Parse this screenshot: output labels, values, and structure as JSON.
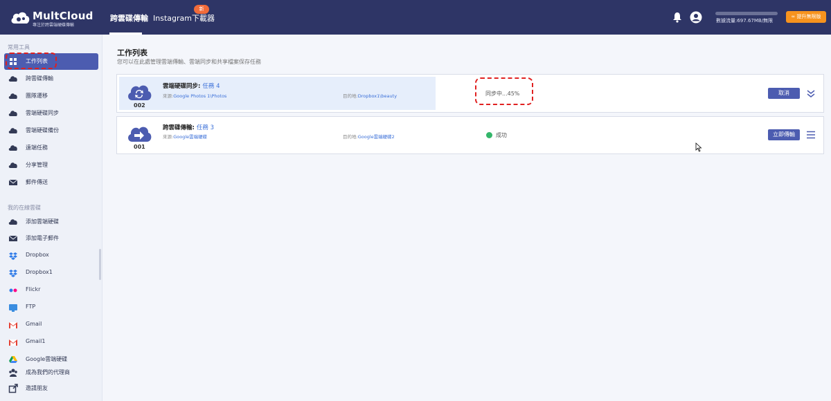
{
  "header": {
    "brand": "MultCloud",
    "tagline": "專注於跨雲端硬碟傳輸",
    "tabs": [
      {
        "label": "跨雲碟傳輸",
        "active": true
      },
      {
        "label": "Instagram下載器",
        "active": false
      }
    ],
    "new_badge": "新",
    "traffic_text": "數據流量:697.67MB/無限",
    "upgrade_label": "∞ 提升無限版",
    "accent_color": "#2e3566"
  },
  "sidebar": {
    "section_common": "常用工具",
    "common_items": [
      {
        "label": "工作列表",
        "icon": "grid-icon"
      },
      {
        "label": "跨雲碟傳輸",
        "icon": "cloud-transfer-icon"
      },
      {
        "label": "團隊遷移",
        "icon": "team-migrate-icon"
      },
      {
        "label": "雲端硬碟同步",
        "icon": "cloud-sync-icon"
      },
      {
        "label": "雲端硬碟備份",
        "icon": "cloud-backup-icon"
      },
      {
        "label": "遠端任務",
        "icon": "remote-task-icon"
      },
      {
        "label": "分享管理",
        "icon": "share-icon"
      },
      {
        "label": "郵件傳送",
        "icon": "mail-icon"
      }
    ],
    "section_online": "我的在線雲碟",
    "online_items": [
      {
        "label": "添加雲端硬碟",
        "icon": "add-cloud-icon"
      },
      {
        "label": "添加電子郵件",
        "icon": "add-mail-icon"
      },
      {
        "label": "Dropbox",
        "icon": "dropbox-icon"
      },
      {
        "label": "Dropbox1",
        "icon": "dropbox-icon"
      },
      {
        "label": "Flickr",
        "icon": "flickr-icon"
      },
      {
        "label": "FTP",
        "icon": "ftp-icon"
      },
      {
        "label": "Gmail",
        "icon": "gmail-icon"
      },
      {
        "label": "Gmail1",
        "icon": "gmail-icon"
      },
      {
        "label": "Google雲端硬碟",
        "icon": "google-drive-icon"
      }
    ],
    "footer_items": [
      {
        "label": "成為我們的代理商",
        "icon": "agent-icon"
      },
      {
        "label": "邀請朋友",
        "icon": "invite-icon"
      }
    ]
  },
  "main": {
    "title": "工作列表",
    "subtitle": "您可以在此處管理雲端傳輸、雲端同步和共享檔案保存任務",
    "tasks": [
      {
        "number": "002",
        "type_label": "雲端硬碟同步:",
        "task_name": "任務 4",
        "source_label": "來源:",
        "source": "Google Photos 1\\Photos",
        "dest_label": "目的地:",
        "dest": "Dropbox1\\beauty",
        "status": "同步中...45%",
        "progress": 45,
        "action": "取消",
        "icon": "cloud-sync-icon"
      },
      {
        "number": "001",
        "type_label": "跨雲碟傳輸:",
        "task_name": "任務 3",
        "source_label": "來源:",
        "source": "Google雲端硬碟",
        "dest_label": "目的地:",
        "dest": "Google雲端硬碟2",
        "status": "成功",
        "action": "立即傳輸",
        "icon": "cloud-transfer-icon"
      }
    ]
  }
}
